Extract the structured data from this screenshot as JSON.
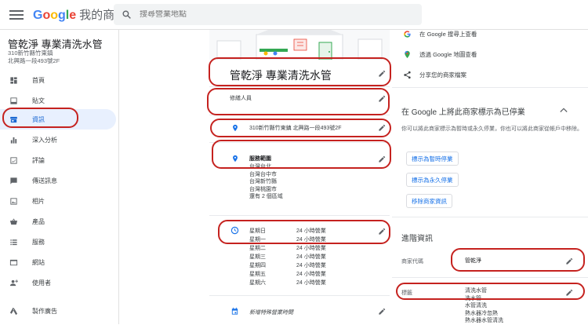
{
  "app": {
    "brand_google": "Google",
    "brand_product": "我的商家",
    "search_placeholder": "搜尋營業地點"
  },
  "business": {
    "name": "管乾淨 專業清洗水管",
    "address_line1": "310新竹縣竹東鎮",
    "address_line2": "北興路一段493號2F"
  },
  "sidebar": {
    "items": [
      {
        "label": "首頁",
        "icon": "home-grid-icon"
      },
      {
        "label": "貼文",
        "icon": "post-icon"
      },
      {
        "label": "資訊",
        "icon": "store-icon",
        "active": true
      },
      {
        "label": "深入分析",
        "icon": "bar-chart-icon"
      },
      {
        "label": "評論",
        "icon": "review-icon"
      },
      {
        "label": "傳送訊息",
        "icon": "message-icon"
      },
      {
        "label": "相片",
        "icon": "photo-icon"
      },
      {
        "label": "產品",
        "icon": "basket-icon"
      },
      {
        "label": "服務",
        "icon": "list-icon"
      },
      {
        "label": "網站",
        "icon": "web-icon"
      },
      {
        "label": "使用者",
        "icon": "add-person-icon"
      },
      {
        "label": "製作廣告",
        "icon": "ads-icon"
      }
    ]
  },
  "info": {
    "title": "管乾淨 專業清洗水管",
    "category": "修繕人員",
    "address": "310新竹縣竹東鎮 北興路一段493號2F",
    "service_area_title": "服務範圍",
    "service_areas": [
      "台灣台北",
      "台灣台中市",
      "台灣新竹縣",
      "台灣桃園市",
      "還有 2 個區域"
    ],
    "hours": [
      {
        "day": "星期日",
        "time": "24 小時營業"
      },
      {
        "day": "星期一",
        "time": "24 小時營業"
      },
      {
        "day": "星期二",
        "time": "24 小時營業"
      },
      {
        "day": "星期三",
        "time": "24 小時營業"
      },
      {
        "day": "星期四",
        "time": "24 小時營業"
      },
      {
        "day": "星期五",
        "time": "24 小時營業"
      },
      {
        "day": "星期六",
        "time": "24 小時營業"
      }
    ],
    "special_hours": "新增特殊營業時間"
  },
  "right": {
    "view_search": "在 Google 搜尋上查看",
    "view_maps": "透過 Google 地圖查看",
    "share": "分享您的商家檔案",
    "closed_title": "在 Google 上將此商家標示為已停業",
    "closed_desc": "你可以將此商家標示為暫時或永久停業，你也可以將此商家從帳戶中移除。",
    "btn_temp": "標示為暫時停業",
    "btn_perm": "標示為永久停業",
    "btn_remove": "移除商家資訊",
    "advanced_title": "進階資訊",
    "store_code_label": "商家代碼",
    "store_code_value": "管乾淨",
    "labels_label": "標籤",
    "labels_values": [
      "清洗水管",
      "洗水管",
      "水管清洗",
      "熱水器冷忽熱",
      "熱水器水管清洗"
    ]
  },
  "colors": {
    "accent_red": "#c5221f",
    "active_blue": "#1967d2",
    "active_bg": "#e8f0fe"
  }
}
